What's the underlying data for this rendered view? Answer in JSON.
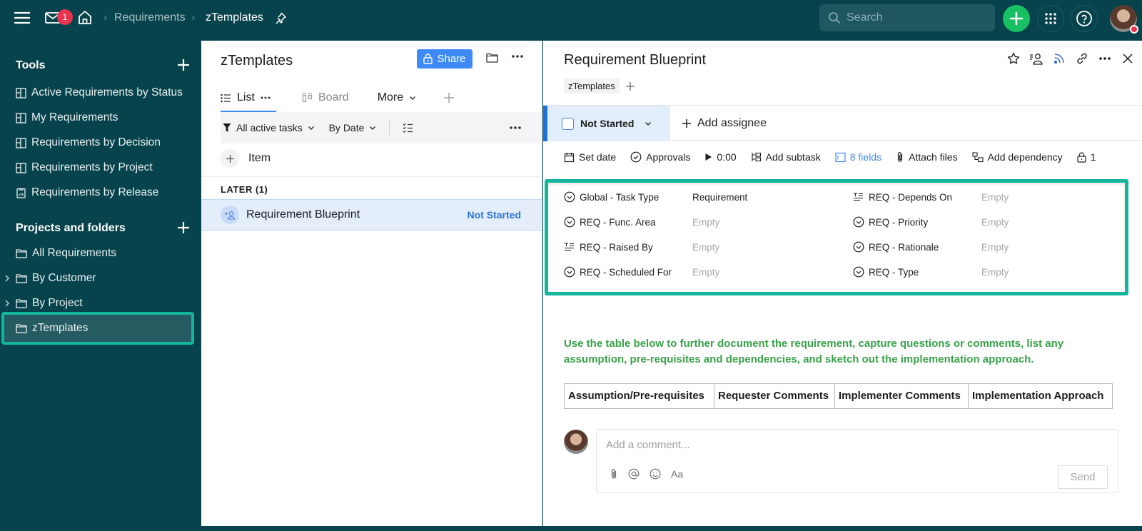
{
  "topbar": {
    "inbox_badge": "1",
    "breadcrumb": [
      "Requirements",
      "zTemplates"
    ],
    "search_placeholder": "Search",
    "icons": [
      "menu-icon",
      "mail-icon",
      "home-icon",
      "pin-icon",
      "search-icon",
      "plus-icon",
      "apps-grid-icon",
      "help-icon",
      "avatar"
    ],
    "colors": {
      "bar": "#07434c",
      "create": "#17c163",
      "badge": "#e8344e"
    }
  },
  "sidebar": {
    "tools_title": "Tools",
    "tools": [
      {
        "label": "Active Requirements by Status",
        "icon": "table-view-icon"
      },
      {
        "label": "My Requirements",
        "icon": "table-view-icon"
      },
      {
        "label": "Requirements by Decision",
        "icon": "table-view-icon"
      },
      {
        "label": "Requirements by Project",
        "icon": "table-view-icon"
      },
      {
        "label": "Requirements by Release",
        "icon": "report-icon"
      }
    ],
    "projects_title": "Projects and folders",
    "folders": [
      {
        "label": "All Requirements",
        "expandable": false
      },
      {
        "label": "By Customer",
        "expandable": true
      },
      {
        "label": "By Project",
        "expandable": true
      },
      {
        "label": "zTemplates",
        "expandable": false,
        "selected": true
      }
    ],
    "highlight_color": "#12b69c"
  },
  "list_panel": {
    "title": "zTemplates",
    "share_label": "Share",
    "tabs": [
      {
        "label": "List",
        "active": true
      },
      {
        "label": "Board",
        "active": false
      },
      {
        "label": "More",
        "active": false
      }
    ],
    "filter_label": "All active tasks",
    "sort_label": "By Date",
    "add_item_label": "Item",
    "group_header": "LATER (1)",
    "tasks": [
      {
        "name": "Requirement Blueprint",
        "status": "Not Started"
      }
    ]
  },
  "detail": {
    "title": "Requirement Blueprint",
    "tag": "zTemplates",
    "status": "Not Started",
    "add_assignee_label": "Add assignee",
    "actions": [
      {
        "label": "Set date",
        "icon": "calendar-icon"
      },
      {
        "label": "Approvals",
        "icon": "check-circle-icon"
      },
      {
        "label": "0:00",
        "icon": "play-icon"
      },
      {
        "label": "Add subtask",
        "icon": "subtask-icon"
      },
      {
        "label": "8 fields",
        "icon": "fields-icon"
      },
      {
        "label": "Attach files",
        "icon": "paperclip-icon"
      },
      {
        "label": "Add dependency",
        "icon": "dependency-icon"
      },
      {
        "label": "1",
        "icon": "lock-icon"
      }
    ],
    "fields": [
      {
        "name": "Global - Task Type",
        "value": "Requirement",
        "icon": "dropdown-circle-icon"
      },
      {
        "name": "REQ - Func. Area",
        "value": "Empty",
        "icon": "dropdown-circle-icon"
      },
      {
        "name": "REQ - Raised By",
        "value": "Empty",
        "icon": "text-field-icon"
      },
      {
        "name": "REQ - Scheduled For",
        "value": "Empty",
        "icon": "dropdown-circle-icon"
      },
      {
        "name": "REQ - Depends On",
        "value": "Empty",
        "icon": "text-field-icon"
      },
      {
        "name": "REQ - Priority",
        "value": "Empty",
        "icon": "dropdown-circle-icon"
      },
      {
        "name": "REQ - Rationale",
        "value": "Empty",
        "icon": "dropdown-circle-icon"
      },
      {
        "name": "REQ - Type",
        "value": "Empty",
        "icon": "dropdown-circle-icon"
      }
    ],
    "instructions": "Use the table below to further document the requirement, capture questions or comments, list any assumption, pre-requisites and dependencies, and sketch out the implementation approach.",
    "table_headers": [
      "Assumption/Pre-requisites",
      "Requester Comments",
      "Implementer Comments",
      "Implementation Approach"
    ],
    "comment_placeholder": "Add a comment...",
    "comment_format_label": "Aa",
    "send_label": "Send",
    "colors": {
      "instructions": "#3aa24b",
      "status_accent": "#1c73d8",
      "fields_link": "#3d8af7"
    }
  }
}
